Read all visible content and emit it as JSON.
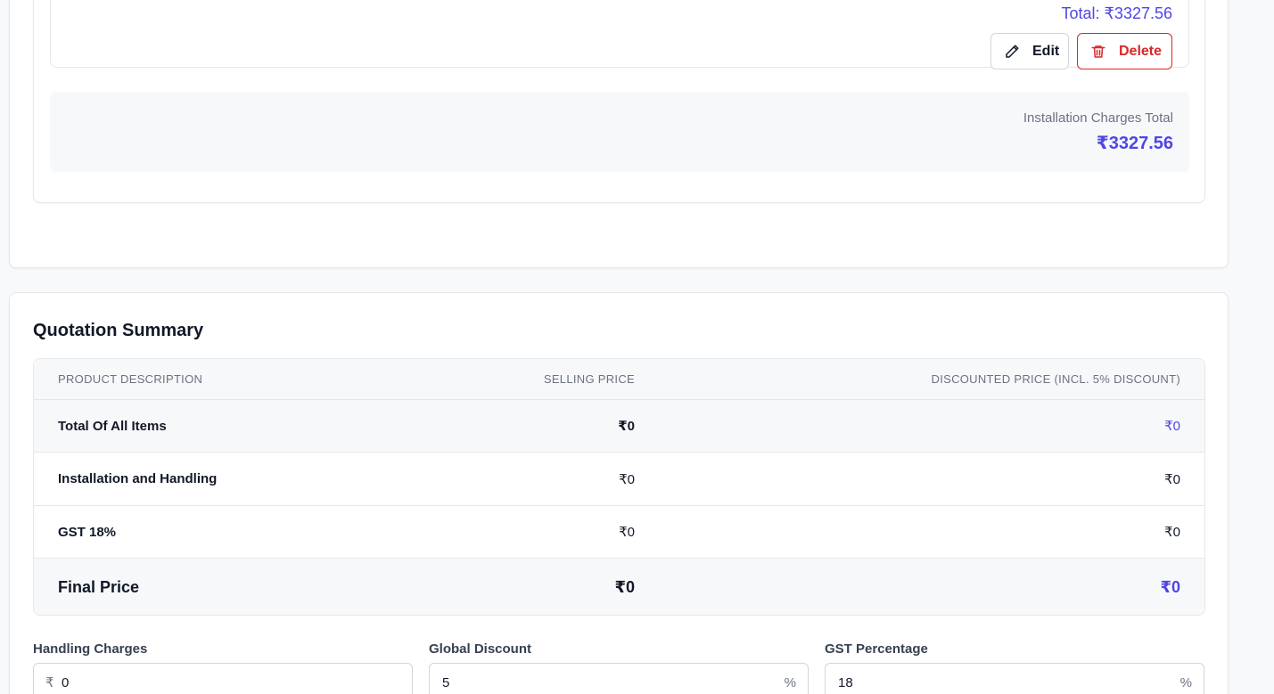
{
  "item": {
    "total": "Total: ₹3327.56",
    "edit_label": "Edit",
    "delete_label": "Delete"
  },
  "installation": {
    "label": "Installation Charges Total",
    "value": "₹3327.56"
  },
  "summary": {
    "title": "Quotation Summary",
    "columns": [
      "PRODUCT DESCRIPTION",
      "SELLING PRICE",
      "DISCOUNTED PRICE (INCL. 5% DISCOUNT)"
    ],
    "rows": [
      {
        "description": "Total Of All Items",
        "selling": "₹0",
        "discounted": "₹0"
      },
      {
        "description": "Installation and Handling",
        "selling": "₹0",
        "discounted": "₹0"
      },
      {
        "description": "GST 18%",
        "selling": "₹0",
        "discounted": "₹0"
      },
      {
        "description": "Final Price",
        "selling": "₹0",
        "discounted": "₹0"
      }
    ]
  },
  "fields": {
    "handling": {
      "label": "Handling Charges",
      "prefix": "₹",
      "value": "0"
    },
    "discount": {
      "label": "Global Discount",
      "suffix": "%",
      "value": "5"
    },
    "gst": {
      "label": "GST Percentage",
      "suffix": "%",
      "value": "18"
    }
  },
  "colors": {
    "accent": "#4f46e5",
    "danger": "#dc2626"
  }
}
